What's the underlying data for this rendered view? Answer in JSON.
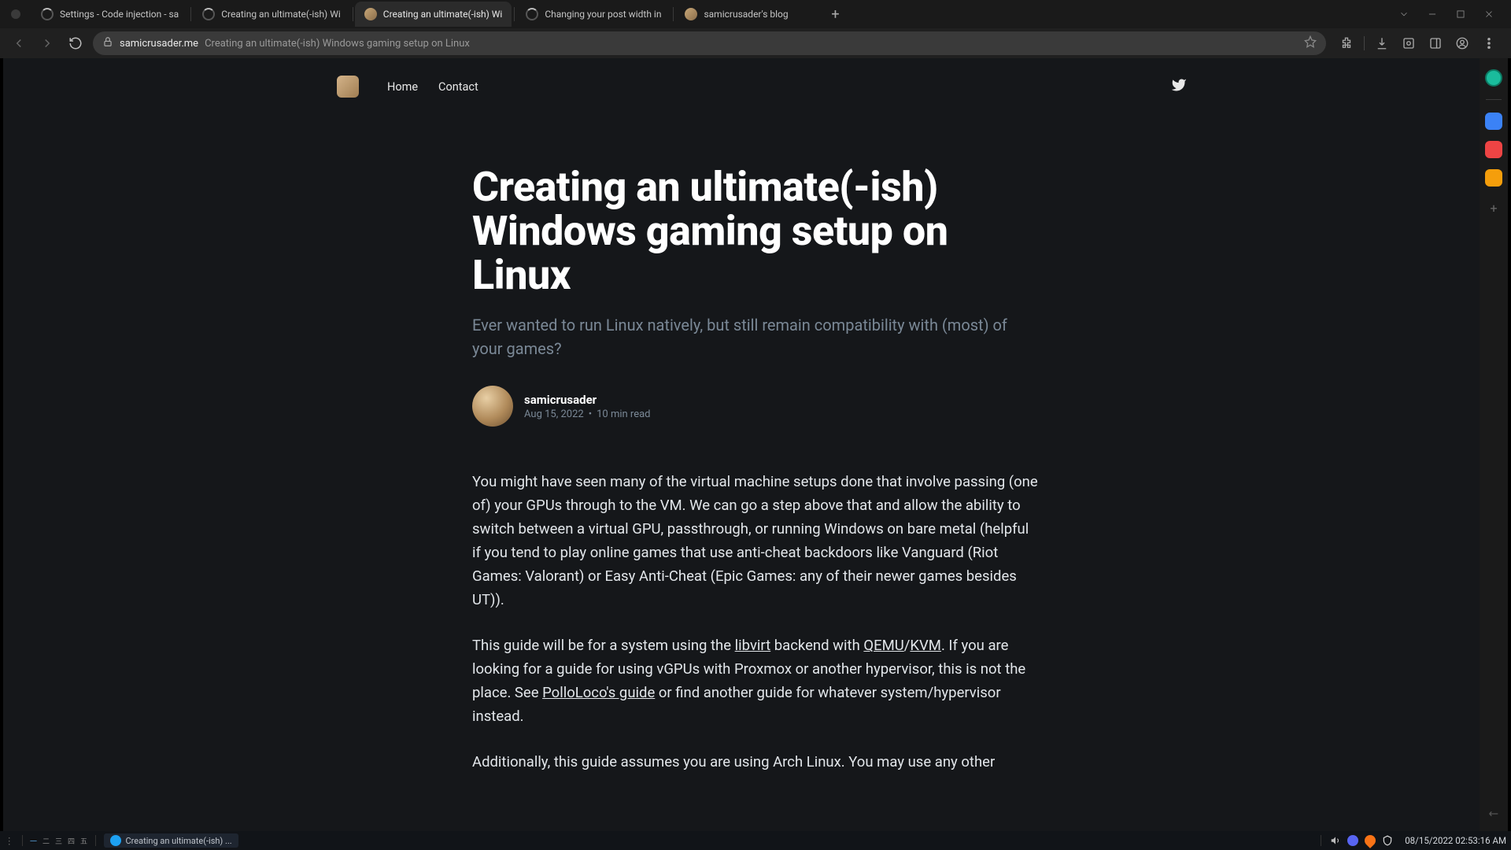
{
  "browser": {
    "tabs": [
      {
        "title": "Settings - Code injection - sa",
        "favicon": "spinner"
      },
      {
        "title": "Creating an ultimate(-ish) Wi",
        "favicon": "spinner"
      },
      {
        "title": "Creating an ultimate(-ish) Wi",
        "favicon": "avatar",
        "active": true
      },
      {
        "title": "Changing your post width in",
        "favicon": "spinner"
      },
      {
        "title": "samicrusader's blog",
        "favicon": "avatar"
      }
    ],
    "url_domain": "samicrusader.me",
    "url_path": "Creating an ultimate(-ish) Windows gaming setup on Linux"
  },
  "site": {
    "nav": {
      "home": "Home",
      "contact": "Contact"
    }
  },
  "article": {
    "title": "Creating an ultimate(-ish) Windows gaming setup on Linux",
    "subtitle": "Ever wanted to run Linux natively, but still remain compatibility with (most) of your games?",
    "author": "samicrusader",
    "date": "Aug 15, 2022",
    "read_time": "10 min read",
    "p1": "You might have seen many of the virtual machine setups done that involve passing (one of) your GPUs through to the VM. We can go a step above that and allow the ability to switch between a virtual GPU, passthrough, or running Windows on bare metal (helpful if you tend to play online games that use anti-cheat backdoors like Vanguard (Riot Games: Valorant) or Easy Anti-Cheat (Epic Games: any of their newer games besides UT)).",
    "p2a": "This guide will be for a system using the ",
    "p2_link1": "libvirt",
    "p2b": " backend with ",
    "p2_link2": "QEMU",
    "p2_slash": "/",
    "p2_link3": "KVM",
    "p2c": ". If you are looking for a guide for using vGPUs with Proxmox or another hypervisor, this is not the place. See ",
    "p2_link4": "PolloLoco's guide",
    "p2d": " or find another guide for whatever system/hypervisor instead.",
    "p3": "Additionally, this guide assumes you are using Arch Linux. You may use any other"
  },
  "workspaces": [
    "一",
    "二",
    "三",
    "四",
    "五"
  ],
  "taskbar": {
    "app_title": "Creating an ultimate(-ish) ...",
    "clock": "08/15/2022 02:53:16 AM"
  }
}
